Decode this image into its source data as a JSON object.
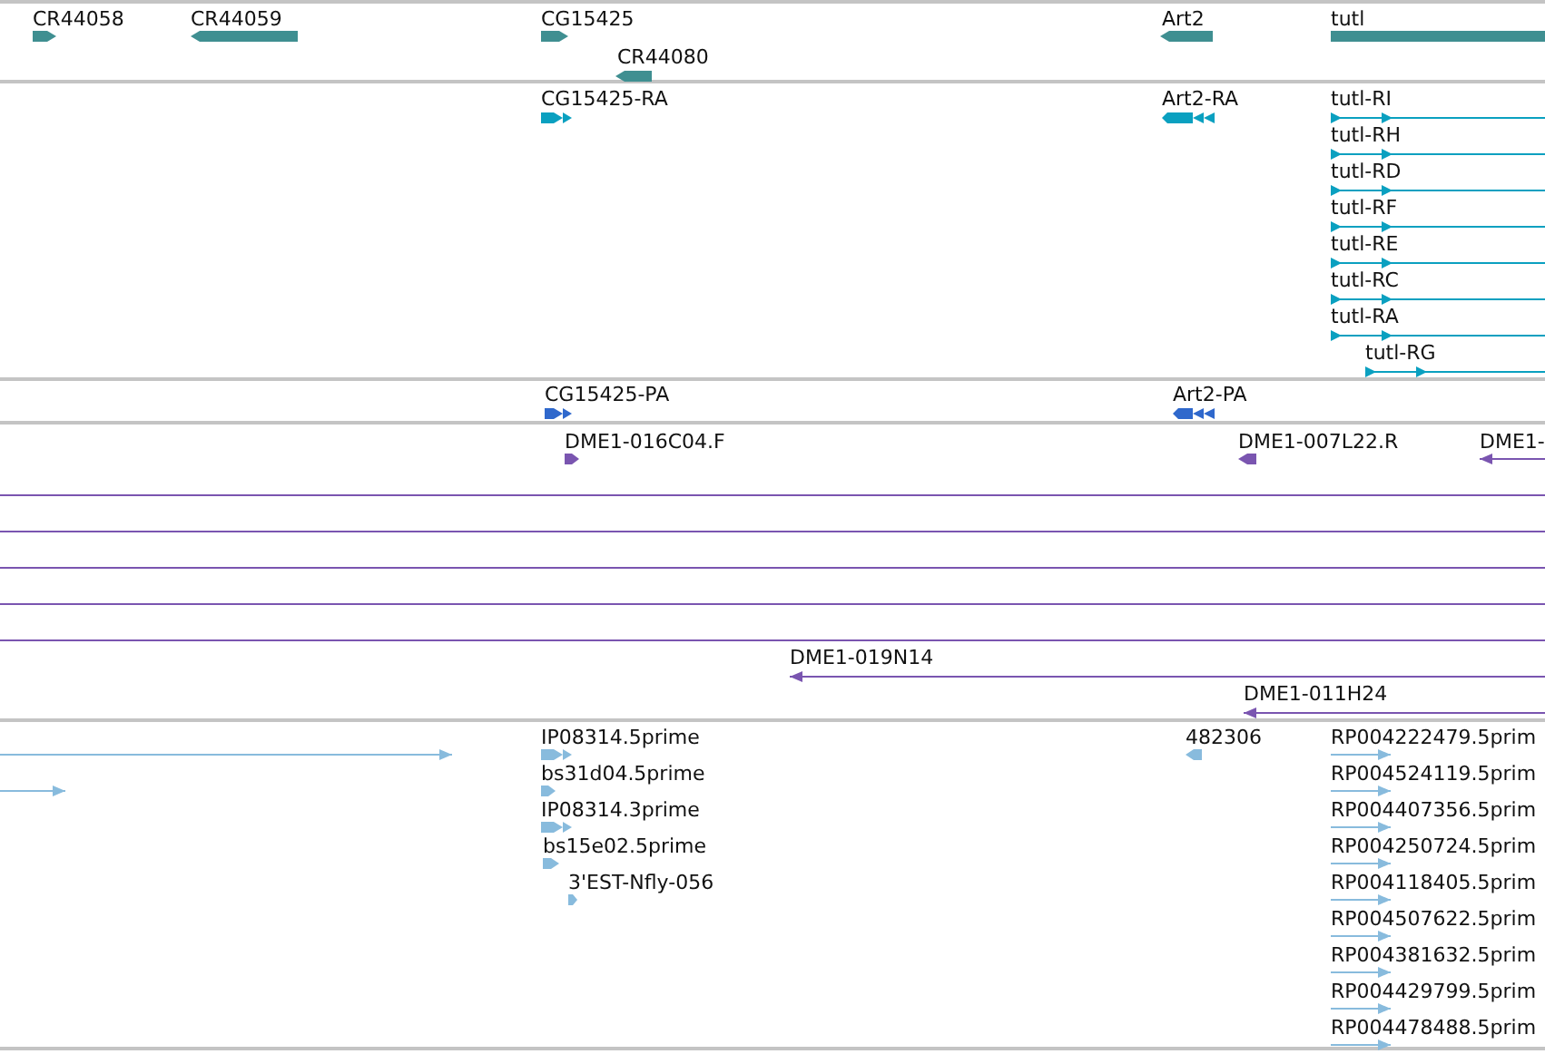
{
  "tracks": [
    {
      "color": "#3f8f91",
      "features": [
        {
          "label": "CR44058",
          "reverse": false,
          "kind": "block"
        },
        {
          "label": "CR44059",
          "reverse": true,
          "kind": "block"
        },
        {
          "label": "CG15425",
          "reverse": false,
          "kind": "block"
        },
        {
          "label": "CR44080",
          "reverse": true,
          "kind": "block"
        },
        {
          "label": "Art2",
          "reverse": true,
          "kind": "block"
        },
        {
          "label": "tutl",
          "reverse": false,
          "kind": "block"
        }
      ]
    },
    {
      "color": "#0aa0c0",
      "features": [
        {
          "label": "CG15425-RA",
          "reverse": false,
          "kind": "exons"
        },
        {
          "label": "Art2-RA",
          "reverse": true,
          "kind": "exons"
        },
        {
          "label": "tutl-RI",
          "reverse": false,
          "kind": "transcript"
        },
        {
          "label": "tutl-RH",
          "reverse": false,
          "kind": "transcript"
        },
        {
          "label": "tutl-RD",
          "reverse": false,
          "kind": "transcript"
        },
        {
          "label": "tutl-RF",
          "reverse": false,
          "kind": "transcript"
        },
        {
          "label": "tutl-RE",
          "reverse": false,
          "kind": "transcript"
        },
        {
          "label": "tutl-RC",
          "reverse": false,
          "kind": "transcript"
        },
        {
          "label": "tutl-RA",
          "reverse": false,
          "kind": "transcript"
        },
        {
          "label": "tutl-RG",
          "reverse": false,
          "kind": "transcript"
        }
      ]
    },
    {
      "color": "#2f68cc",
      "features": [
        {
          "label": "CG15425-PA",
          "reverse": false,
          "kind": "exons"
        },
        {
          "label": "Art2-PA",
          "reverse": true,
          "kind": "exons"
        }
      ]
    },
    {
      "color": "#7a55b0",
      "features": [
        {
          "label": "DME1-016C04.F",
          "reverse": false,
          "kind": "block"
        },
        {
          "label": "DME1-007L22.R",
          "reverse": true,
          "kind": "block"
        },
        {
          "label": "DME1-",
          "reverse": true,
          "kind": "line"
        },
        {
          "kind": "span"
        },
        {
          "kind": "span"
        },
        {
          "kind": "span"
        },
        {
          "kind": "span"
        },
        {
          "kind": "span"
        },
        {
          "label": "DME1-019N14",
          "reverse": true,
          "kind": "line"
        },
        {
          "label": "DME1-011H24",
          "reverse": true,
          "kind": "line"
        }
      ]
    },
    {
      "color": "#88bbdd",
      "features": [
        {
          "reverse": false,
          "kind": "line"
        },
        {
          "reverse": false,
          "kind": "line"
        },
        {
          "label": "IP08314.5prime",
          "reverse": false,
          "kind": "exons"
        },
        {
          "label": "bs31d04.5prime",
          "reverse": false,
          "kind": "block"
        },
        {
          "label": "IP08314.3prime",
          "reverse": false,
          "kind": "exons"
        },
        {
          "label": "bs15e02.5prime",
          "reverse": false,
          "kind": "block"
        },
        {
          "label": "3'EST-Nfly-056",
          "reverse": false,
          "kind": "block"
        },
        {
          "label": "482306",
          "reverse": true,
          "kind": "block"
        },
        {
          "label": "RP004222479.5prim",
          "reverse": false,
          "kind": "line"
        },
        {
          "label": "RP004524119.5prim",
          "reverse": false,
          "kind": "line"
        },
        {
          "label": "RP004407356.5prim",
          "reverse": false,
          "kind": "line"
        },
        {
          "label": "RP004250724.5prim",
          "reverse": false,
          "kind": "line"
        },
        {
          "label": "RP004118405.5prim",
          "reverse": false,
          "kind": "line"
        },
        {
          "label": "RP004507622.5prim",
          "reverse": false,
          "kind": "line"
        },
        {
          "label": "RP004381632.5prim",
          "reverse": false,
          "kind": "line"
        },
        {
          "label": "RP004429799.5prim",
          "reverse": false,
          "kind": "line"
        },
        {
          "label": "RP004478488.5prim",
          "reverse": false,
          "kind": "line"
        }
      ]
    }
  ]
}
